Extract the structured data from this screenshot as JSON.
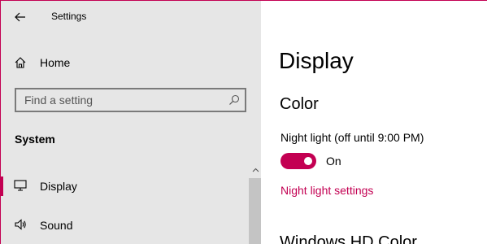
{
  "app": {
    "title": "Settings"
  },
  "sidebar": {
    "home_label": "Home",
    "search_placeholder": "Find a setting",
    "section_label": "System",
    "items": [
      {
        "label": "Display",
        "icon": "monitor-icon",
        "selected": true
      },
      {
        "label": "Sound",
        "icon": "speaker-icon",
        "selected": false
      }
    ]
  },
  "main": {
    "title": "Display",
    "section": "Color",
    "night_light": {
      "label": "Night light (off until 9:00 PM)",
      "state_text": "On",
      "on": true
    },
    "link_label": "Night light settings",
    "next_section": "Windows HD Color"
  },
  "colors": {
    "accent": "#c30052",
    "sidebar_bg": "#e6e6e6"
  }
}
